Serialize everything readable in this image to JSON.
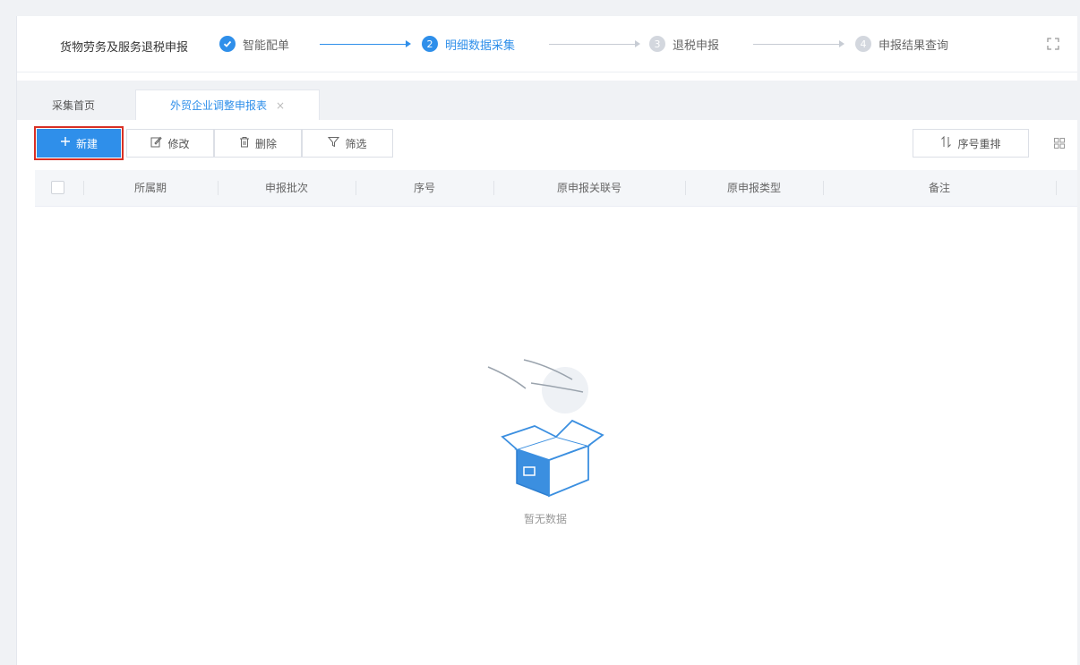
{
  "app_title": "货物劳务及服务退税申报",
  "steps": [
    {
      "number": "1",
      "label": "智能配单",
      "status": "done"
    },
    {
      "number": "2",
      "label": "明细数据采集",
      "status": "active"
    },
    {
      "number": "3",
      "label": "退税申报",
      "status": "pending"
    },
    {
      "number": "4",
      "label": "申报结果查询",
      "status": "pending"
    }
  ],
  "tabs": {
    "home": "采集首页",
    "current": "外贸企业调整申报表",
    "close_glyph": "×"
  },
  "toolbar": {
    "new_label": "新建",
    "edit_label": "修改",
    "delete_label": "删除",
    "filter_label": "筛选",
    "reorder_label": "序号重排"
  },
  "table": {
    "columns": [
      "所属期",
      "申报批次",
      "序号",
      "原申报关联号",
      "原申报类型",
      "备注"
    ]
  },
  "empty_state": {
    "text": "暂无数据"
  },
  "colors": {
    "accent": "#2f8fea",
    "highlight_border": "#d93025"
  }
}
